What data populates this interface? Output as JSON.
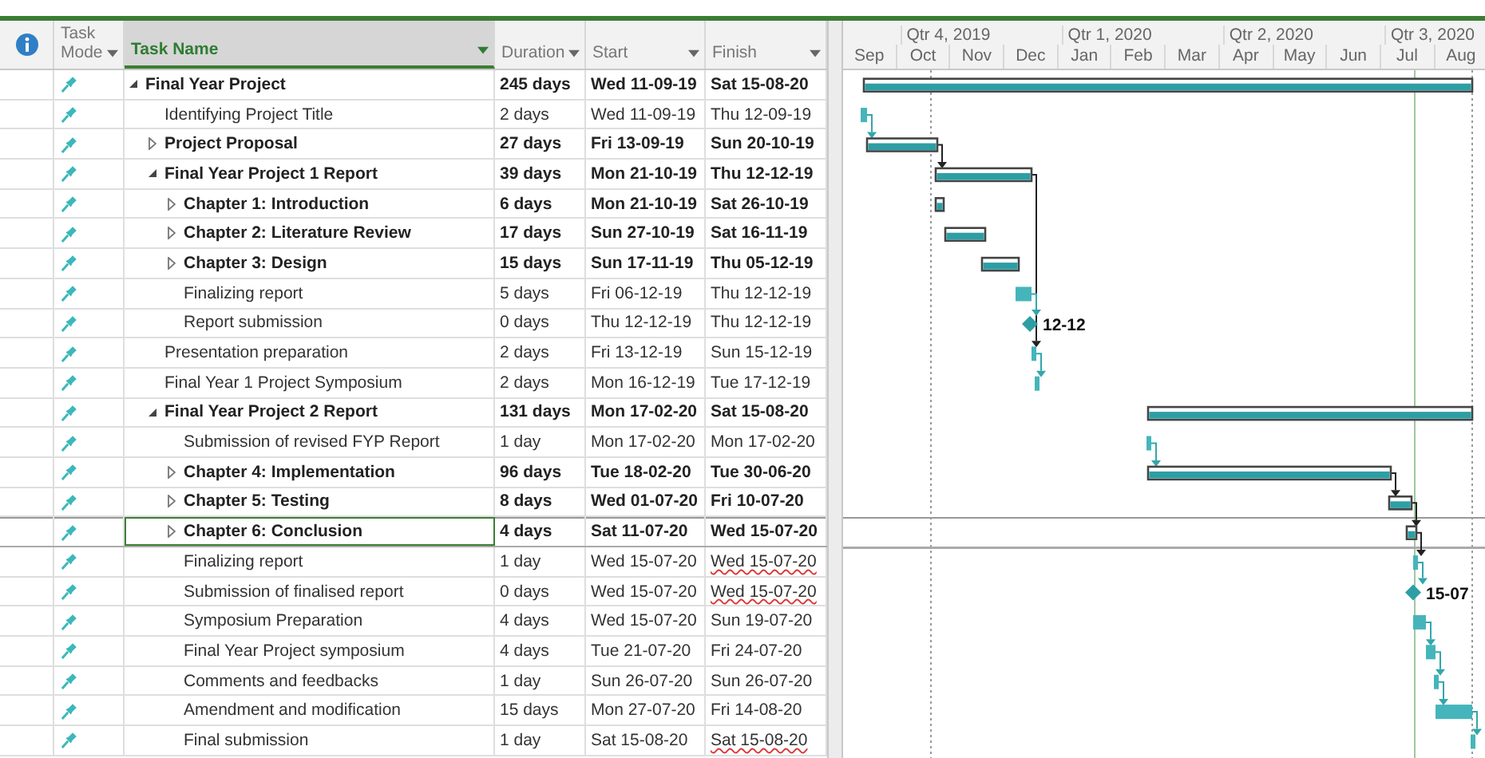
{
  "columns": [
    {
      "label": "Task Mode",
      "selected": false
    },
    {
      "label": "Task Name",
      "selected": true
    },
    {
      "label": "Duration",
      "selected": false
    },
    {
      "label": "Start",
      "selected": false
    },
    {
      "label": "Finish",
      "selected": false
    }
  ],
  "timescale": {
    "quarters": [
      "Qtr 4, 2019",
      "Qtr 1, 2020",
      "Qtr 2, 2020",
      "Qtr 3, 2020"
    ],
    "months": [
      "Sep",
      "Oct",
      "Nov",
      "Dec",
      "Jan",
      "Feb",
      "Mar",
      "Apr",
      "May",
      "Jun",
      "Jul",
      "Aug"
    ]
  },
  "tasks": [
    {
      "name": "Final Year Project",
      "kind": "summary",
      "expanded": true,
      "duration": "245 days",
      "start": "Wed 11-09-19",
      "finish": "Sat 15-08-20",
      "finish_flagged": false,
      "selected": false,
      "children": [
        {
          "name": "Identifying Project Title",
          "kind": "task",
          "duration": "2 days",
          "start": "Wed 11-09-19",
          "finish": "Thu 12-09-19",
          "finish_flagged": false,
          "selected": false
        },
        {
          "name": "Project Proposal",
          "kind": "summary",
          "expanded": false,
          "duration": "27 days",
          "start": "Fri 13-09-19",
          "finish": "Sun 20-10-19",
          "finish_flagged": false,
          "selected": false
        },
        {
          "name": "Final Year Project 1 Report",
          "kind": "summary",
          "expanded": true,
          "duration": "39 days",
          "start": "Mon 21-10-19",
          "finish": "Thu 12-12-19",
          "finish_flagged": false,
          "selected": false,
          "children": [
            {
              "name": "Chapter 1: Introduction",
              "kind": "summary",
              "expanded": false,
              "duration": "6 days",
              "start": "Mon 21-10-19",
              "finish": "Sat 26-10-19",
              "finish_flagged": false,
              "selected": false
            },
            {
              "name": "Chapter 2: Literature Review",
              "kind": "summary",
              "expanded": false,
              "duration": "17 days",
              "start": "Sun 27-10-19",
              "finish": "Sat 16-11-19",
              "finish_flagged": false,
              "selected": false
            },
            {
              "name": "Chapter 3: Design",
              "kind": "summary",
              "expanded": false,
              "duration": "15 days",
              "start": "Sun 17-11-19",
              "finish": "Thu 05-12-19",
              "finish_flagged": false,
              "selected": false
            },
            {
              "name": "Finalizing report",
              "kind": "task",
              "duration": "5 days",
              "start": "Fri 06-12-19",
              "finish": "Thu 12-12-19",
              "finish_flagged": false,
              "selected": false
            },
            {
              "name": "Report submission",
              "kind": "milestone",
              "label": "12-12",
              "duration": "0 days",
              "start": "Thu 12-12-19",
              "finish": "Thu 12-12-19",
              "finish_flagged": false,
              "selected": false
            }
          ]
        },
        {
          "name": "Presentation preparation",
          "kind": "task",
          "duration": "2 days",
          "start": "Fri 13-12-19",
          "finish": "Sun 15-12-19",
          "finish_flagged": false,
          "selected": false
        },
        {
          "name": "Final Year 1 Project Symposium",
          "kind": "task",
          "duration": "2 days",
          "start": "Mon 16-12-19",
          "finish": "Tue 17-12-19",
          "finish_flagged": false,
          "selected": false
        },
        {
          "name": "Final Year Project 2 Report",
          "kind": "summary",
          "expanded": true,
          "duration": "131 days",
          "start": "Mon 17-02-20",
          "finish": "Sat 15-08-20",
          "finish_flagged": false,
          "selected": false,
          "children": [
            {
              "name": "Submission of revised FYP Report",
              "kind": "task",
              "duration": "1 day",
              "start": "Mon 17-02-20",
              "finish": "Mon 17-02-20",
              "finish_flagged": false,
              "selected": false
            },
            {
              "name": "Chapter 4: Implementation",
              "kind": "summary",
              "expanded": false,
              "duration": "96 days",
              "start": "Tue 18-02-20",
              "finish": "Tue 30-06-20",
              "finish_flagged": false,
              "selected": false
            },
            {
              "name": "Chapter 5: Testing",
              "kind": "summary",
              "expanded": false,
              "duration": "8 days",
              "start": "Wed 01-07-20",
              "finish": "Fri 10-07-20",
              "finish_flagged": false,
              "selected": false
            },
            {
              "name": "Chapter 6: Conclusion",
              "kind": "summary",
              "expanded": false,
              "duration": "4 days",
              "start": "Sat 11-07-20",
              "finish": "Wed 15-07-20",
              "finish_flagged": false,
              "selected": true
            },
            {
              "name": "Finalizing report",
              "kind": "task",
              "duration": "1 day",
              "start": "Wed 15-07-20",
              "finish": "Wed 15-07-20",
              "finish_flagged": true,
              "selected": false
            },
            {
              "name": "Submission of finalised report",
              "kind": "milestone",
              "label": "15-07",
              "duration": "0 days",
              "start": "Wed 15-07-20",
              "finish": "Wed 15-07-20",
              "finish_flagged": true,
              "selected": false
            },
            {
              "name": "Symposium Preparation",
              "kind": "task",
              "duration": "4 days",
              "start": "Wed 15-07-20",
              "finish": "Sun 19-07-20",
              "finish_flagged": false,
              "selected": false
            },
            {
              "name": "Final Year Project symposium",
              "kind": "task",
              "duration": "4 days",
              "start": "Tue 21-07-20",
              "finish": "Fri 24-07-20",
              "finish_flagged": false,
              "selected": false
            },
            {
              "name": "Comments and feedbacks",
              "kind": "task",
              "duration": "1 day",
              "start": "Sun 26-07-20",
              "finish": "Sun 26-07-20",
              "finish_flagged": false,
              "selected": false
            },
            {
              "name": "Amendment and modification",
              "kind": "task",
              "duration": "15 days",
              "start": "Mon 27-07-20",
              "finish": "Fri 14-08-20",
              "finish_flagged": false,
              "selected": false
            },
            {
              "name": "Final submission",
              "kind": "task",
              "duration": "1 day",
              "start": "Sat 15-08-20",
              "finish": "Sat 15-08-20",
              "finish_flagged": true,
              "selected": false
            }
          ]
        }
      ]
    }
  ]
}
